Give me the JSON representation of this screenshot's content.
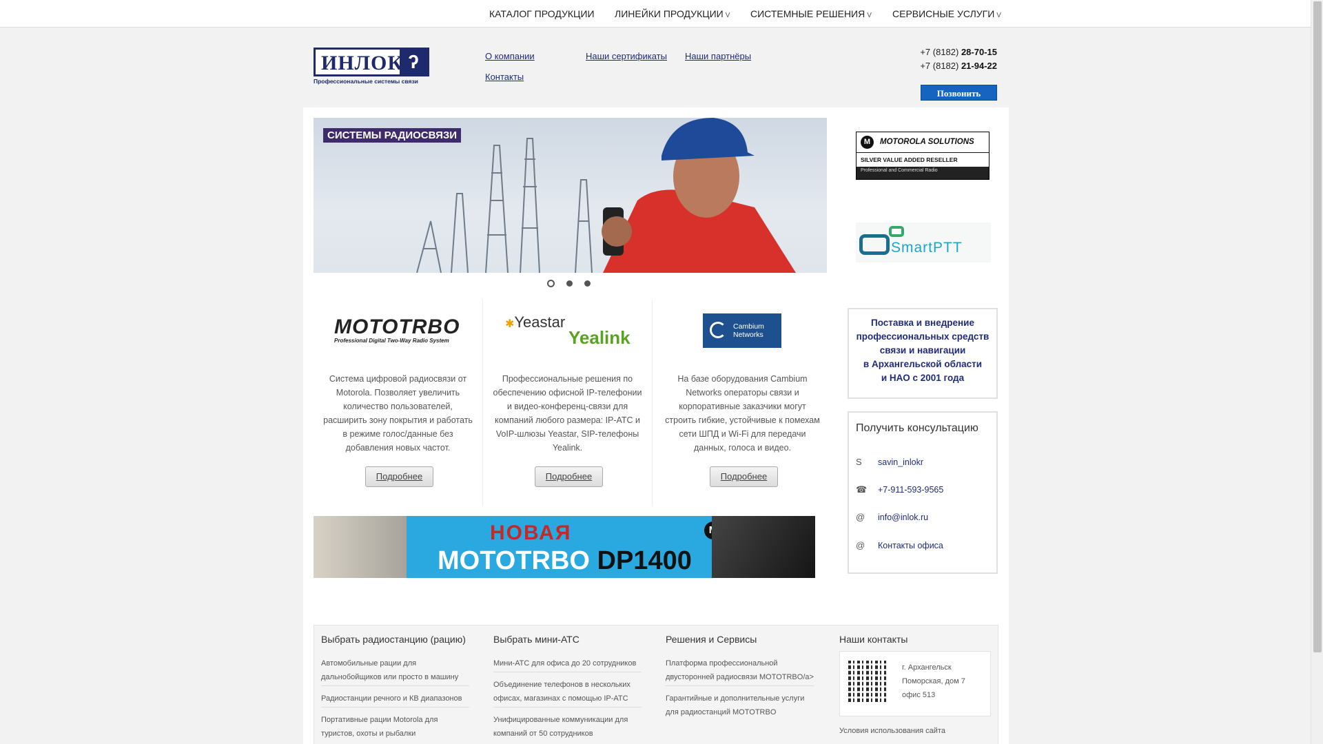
{
  "topnav": {
    "items": [
      {
        "label": "КАТАЛОГ ПРОДУКЦИИ",
        "chev": ""
      },
      {
        "label": "ЛИНЕЙКИ ПРОДУКЦИИ",
        "chev": "v"
      },
      {
        "label": "СИСТЕМНЫЕ РЕШЕНИЯ",
        "chev": "v"
      },
      {
        "label": "СЕРВИСНЫЕ УСЛУГИ",
        "chev": "v"
      }
    ]
  },
  "header": {
    "logo_word": "ИНЛОК",
    "logo_tagline": "Профессиональные системы связи",
    "links": {
      "about": "О компании",
      "contacts": "Контакты",
      "certificates": "Наши сертификаты",
      "partners": "Наши партнёры"
    },
    "phones": [
      {
        "prefix": "+7 (8182) ",
        "number": "28-70-15"
      },
      {
        "prefix": "+7 (8182) ",
        "number": "21-94-22"
      }
    ],
    "call_button": "Позвонить"
  },
  "banner": {
    "label": "СИСТЕМЫ РАДИОСВЯЗИ",
    "slides": 3,
    "active_slide": 1
  },
  "cards": [
    {
      "logo": "MOTOTRBO",
      "logo_sub": "Professional Digital Two-Way Radio System",
      "description": "Система цифровой радиосвязи от Motorola. Позволяет увеличить количество пользователей, расширить зону покрытия и работать в режиме голос/данные без добавления новых частот.",
      "button": "Подробнее"
    },
    {
      "logo": "Yeastar",
      "logo2": "Yealink",
      "description": "Профессиональные решения по обеспечению офисной IP-телефонии и видео-конференц-связи для компаний любого размера: IP-АТС и VoIP-шлюзы Yeastar, SIP-телефоны Yealink.",
      "button": "Подробнее"
    },
    {
      "logo": "Cambium",
      "logo2": "Networks",
      "description": "На базе оборудования Cambium Networks операторы связи и корпоративные заказчики могут строить гибкие, устойчивые к помехам сети ШПД и Wi-Fi для передачи данных, голоса и видео.",
      "button": "Подробнее"
    }
  ],
  "promo": {
    "line1": "НОВАЯ",
    "line2a": "MOTOTRBO",
    "line2b": "DP1400"
  },
  "sidebar": {
    "motorola": {
      "brand": "MOTOROLA SOLUTIONS",
      "level": "SILVER VALUE ADDED RESELLER",
      "segment": "Professional and Commercial Radio"
    },
    "smartptt": "SmartPTT",
    "info_lines": [
      "Поставка и внедрение",
      "профессиональных средств",
      "связи и навигации",
      "в Архангельской области",
      "и НАО с 2001 года"
    ],
    "consult": {
      "title": "Получить консультацию",
      "rows": [
        {
          "icon": "skype-icon",
          "glyph": "S",
          "text": "savin_inlokr"
        },
        {
          "icon": "phone-icon",
          "glyph": "☎",
          "text": "+7-911-593-9565"
        },
        {
          "icon": "at-icon",
          "glyph": "@",
          "text": "info@inlok.ru"
        },
        {
          "icon": "at-icon",
          "glyph": "@",
          "text": "Контакты офиса"
        }
      ]
    }
  },
  "footer": {
    "columns": [
      {
        "title": "Выбрать радиостанцию (рацию)",
        "links": [
          "Автомобильные рации для дальнобойщиков или просто в машину",
          "Радиостанции речного и КВ диапазонов",
          "Портативные рации Motorola для туристов, охоты и рыбалки"
        ]
      },
      {
        "title": "Выбрать мини-АТС",
        "links": [
          "Мини-АТС для офиса до 20 сотрудников",
          "Объединение телефонов в нескольких офисах, магазинах с помощью IP-АТС",
          "Унифицированные коммуникации для компаний от 50 сотрудников"
        ]
      },
      {
        "title": "Решения и Сервисы",
        "links": [
          "Платформа профессиональной двусторонней радиосвязи MOTOTRBO/a>",
          "Гарантийные и дополнительные услуги для радиостанций MOTOTRBO"
        ]
      },
      {
        "title": "Наши контакты",
        "address": [
          "г. Архангельск",
          "Поморская, дом 7",
          "офис 513"
        ],
        "terms": "Условия использования сайта"
      }
    ]
  },
  "colors": {
    "brand_navy": "#1e2a6b",
    "link_blue": "#1f2b7a",
    "call_button": "#1565c0",
    "promo_blue": "#29a9e0"
  }
}
